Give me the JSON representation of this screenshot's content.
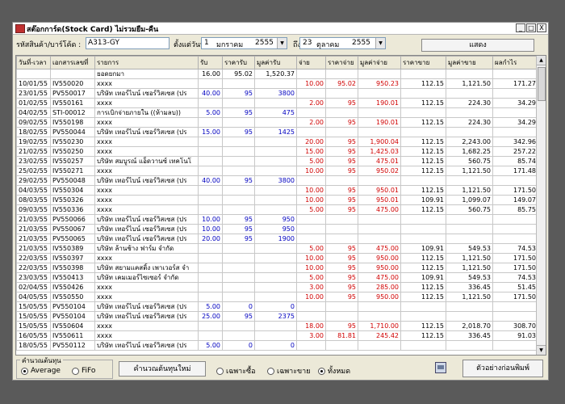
{
  "window": {
    "title": "สต๊อกการ์ด(Stock Card) ไม่รวมยืม-คืน",
    "buttons": [
      "_",
      "□",
      "X"
    ]
  },
  "filter": {
    "product_label": "รหัสสินค้า/บาร์โค้ด :",
    "product_value": "A313-GY",
    "from_label": "ตั้งแต่วันที่",
    "from_day": "1",
    "from_month": "มกราคม",
    "from_year": "2555",
    "to_label": "ถึง",
    "to_day": "23",
    "to_month": "ตุลาคม",
    "to_year": "2555",
    "show_button": "แสดง"
  },
  "table": {
    "headers": [
      "วันที่-เวลา",
      "เอกสารเลขที่",
      "รายการ",
      "รับ",
      "ราคารับ",
      "มูลค่ารับ",
      "จ่าย",
      "ราคาจ่าย",
      "มูลค่าจ่าย",
      "ราคาขาย",
      "มูลค่าขาย",
      "ผลกำไร"
    ],
    "rows": [
      [
        "",
        "",
        "ยอดยกมา",
        "16.00",
        "95.02",
        "1,520.37",
        "",
        "",
        "",
        "",
        "",
        ""
      ],
      [
        "10/01/55",
        "IV550020",
        "xxxx",
        "",
        "",
        "",
        "10.00",
        "95.02",
        "950.23",
        "112.15",
        "1,121.50",
        "171.27"
      ],
      [
        "23/01/55",
        "PV550017",
        "บริษัท เทอร์ไบน์ เซอร์วิสเซส (ปร",
        "40.00",
        "95",
        "3800",
        "",
        "",
        "",
        "",
        "",
        ""
      ],
      [
        "01/02/55",
        "IV550161",
        "xxxx",
        "",
        "",
        "",
        "2.00",
        "95",
        "190.01",
        "112.15",
        "224.30",
        "34.29"
      ],
      [
        "04/02/55",
        "STI-00012",
        "การเบิกจ่ายภายใน ((ห้ามลบ))",
        "5.00",
        "95",
        "475",
        "",
        "",
        "",
        "",
        "",
        ""
      ],
      [
        "09/02/55",
        "IV550198",
        "xxxx",
        "",
        "",
        "",
        "2.00",
        "95",
        "190.01",
        "112.15",
        "224.30",
        "34.29"
      ],
      [
        "18/02/55",
        "PV550044",
        "บริษัท เทอร์ไบน์ เซอร์วิสเซส (ปร",
        "15.00",
        "95",
        "1425",
        "",
        "",
        "",
        "",
        "",
        ""
      ],
      [
        "19/02/55",
        "IV550230",
        "xxxx",
        "",
        "",
        "",
        "20.00",
        "95",
        "1,900.04",
        "112.15",
        "2,243.00",
        "342.96"
      ],
      [
        "21/02/55",
        "IV550250",
        "xxxx",
        "",
        "",
        "",
        "15.00",
        "95",
        "1,425.03",
        "112.15",
        "1,682.25",
        "257.22"
      ],
      [
        "23/02/55",
        "IV550257",
        "บริษัท สมบูรณ์ แอ็ดวานซ์ เทคโนโ",
        "",
        "",
        "",
        "5.00",
        "95",
        "475.01",
        "112.15",
        "560.75",
        "85.74"
      ],
      [
        "25/02/55",
        "IV550271",
        "xxxx",
        "",
        "",
        "",
        "10.00",
        "95",
        "950.02",
        "112.15",
        "1,121.50",
        "171.48"
      ],
      [
        "29/02/55",
        "PV550048",
        "บริษัท เทอร์ไบน์ เซอร์วิสเซส (ปร",
        "40.00",
        "95",
        "3800",
        "",
        "",
        "",
        "",
        "",
        ""
      ],
      [
        "04/03/55",
        "IV550304",
        "xxxx",
        "",
        "",
        "",
        "10.00",
        "95",
        "950.01",
        "112.15",
        "1,121.50",
        "171.50"
      ],
      [
        "08/03/55",
        "IV550326",
        "xxxx",
        "",
        "",
        "",
        "10.00",
        "95",
        "950.01",
        "109.91",
        "1,099.07",
        "149.07"
      ],
      [
        "09/03/55",
        "IV550336",
        "xxxx",
        "",
        "",
        "",
        "5.00",
        "95",
        "475.00",
        "112.15",
        "560.75",
        "85.75"
      ],
      [
        "21/03/55",
        "PV550066",
        "บริษัท เทอร์ไบน์ เซอร์วิสเซส (ปร",
        "10.00",
        "95",
        "950",
        "",
        "",
        "",
        "",
        "",
        ""
      ],
      [
        "21/03/55",
        "PV550067",
        "บริษัท เทอร์ไบน์ เซอร์วิสเซส (ปร",
        "10.00",
        "95",
        "950",
        "",
        "",
        "",
        "",
        "",
        ""
      ],
      [
        "21/03/55",
        "PV550065",
        "บริษัท เทอร์ไบน์ เซอร์วิสเซส (ปร",
        "20.00",
        "95",
        "1900",
        "",
        "",
        "",
        "",
        "",
        ""
      ],
      [
        "21/03/55",
        "IV550389",
        "บริษัท ล้านช้าง ฟาร์ม จำกัด",
        "",
        "",
        "",
        "5.00",
        "95",
        "475.00",
        "109.91",
        "549.53",
        "74.53"
      ],
      [
        "22/03/55",
        "IV550397",
        "xxxx",
        "",
        "",
        "",
        "10.00",
        "95",
        "950.00",
        "112.15",
        "1,121.50",
        "171.50"
      ],
      [
        "22/03/55",
        "IV550398",
        "บริษัท สยามแคสติ้ง เพาเวอร์ส จำ",
        "",
        "",
        "",
        "10.00",
        "95",
        "950.00",
        "112.15",
        "1,121.50",
        "171.50"
      ],
      [
        "23/03/55",
        "IV550413",
        "บริษัท เคมเมอร์ไซเซอร์ จำกัด",
        "",
        "",
        "",
        "5.00",
        "95",
        "475.00",
        "109.91",
        "549.53",
        "74.53"
      ],
      [
        "02/04/55",
        "IV550426",
        "xxxx",
        "",
        "",
        "",
        "3.00",
        "95",
        "285.00",
        "112.15",
        "336.45",
        "51.45"
      ],
      [
        "04/05/55",
        "IV550550",
        "xxxx",
        "",
        "",
        "",
        "10.00",
        "95",
        "950.00",
        "112.15",
        "1,121.50",
        "171.50"
      ],
      [
        "15/05/55",
        "PV550104",
        "บริษัท เทอร์ไบน์ เซอร์วิสเซส (ปร",
        "5.00",
        "0",
        "0",
        "",
        "",
        "",
        "",
        "",
        ""
      ],
      [
        "15/05/55",
        "PV550104",
        "บริษัท เทอร์ไบน์ เซอร์วิสเซส (ปร",
        "25.00",
        "95",
        "2375",
        "",
        "",
        "",
        "",
        "",
        ""
      ],
      [
        "15/05/55",
        "IV550604",
        "xxxx",
        "",
        "",
        "",
        "18.00",
        "95",
        "1,710.00",
        "112.15",
        "2,018.70",
        "308.70"
      ],
      [
        "16/05/55",
        "IV550611",
        "xxxx",
        "",
        "",
        "",
        "3.00",
        "81.81",
        "245.42",
        "112.15",
        "336.45",
        "91.03"
      ],
      [
        "18/05/55",
        "PV550112",
        "บริษัท เทอร์ไบน์ เซอร์วิสเซส (ปร",
        "5.00",
        "0",
        "0",
        "",
        "",
        "",
        "",
        "",
        ""
      ]
    ]
  },
  "bottom": {
    "calc_group_label": "คำนวณต้นทุน",
    "average_label": "Average",
    "fifo_label": "FiFo",
    "recalc_button": "คำนวณต้นทุนใหม่",
    "filter_buy": "เฉพาะซื้อ",
    "filter_sell": "เฉพาะขาย",
    "filter_all": "ทั้งหมด",
    "preview_button": "ตัวอย่างก่อนพิมพ์"
  }
}
